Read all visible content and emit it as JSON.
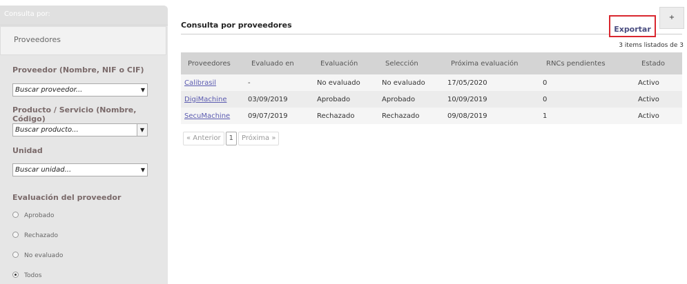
{
  "sidebar": {
    "title": "Consulta por:",
    "tab": "Proveedores",
    "filters": {
      "proveedor_label": "Proveedor (Nombre, NIF o CIF)",
      "proveedor_value": "Buscar proveedor...",
      "producto_label": "Producto / Servicio (Nombre, Código)",
      "producto_value": "Buscar producto...",
      "unidad_label": "Unidad",
      "unidad_value": "Buscar unidad...",
      "evaluacion_label": "Evaluación del proveedor",
      "radios": [
        "Aprobado",
        "Rechazado",
        "No evaluado",
        "Todos"
      ],
      "selected_radio": "Todos"
    }
  },
  "main": {
    "title": "Consulta por proveedores",
    "export_label": "Exportar",
    "plus_label": "+",
    "items_count": "3 items listados de 3",
    "columns": [
      "Proveedores",
      "Evaluado en",
      "Evaluación",
      "Selección",
      "Próxima evaluación",
      "RNCs pendientes",
      "Estado"
    ],
    "rows": [
      [
        "Calibrasil",
        "-",
        "No evaluado",
        "No evaluado",
        "17/05/2020",
        "0",
        "Activo"
      ],
      [
        "DigiMachine",
        "03/09/2019",
        "Aprobado",
        "Aprobado",
        "10/09/2019",
        "0",
        "Activo"
      ],
      [
        "SecuMachine",
        "09/07/2019",
        "Rechazado",
        "Rechazado",
        "09/08/2019",
        "1",
        "Activo"
      ]
    ],
    "pager": {
      "prev": "« Anterior",
      "current": "1",
      "next": "Próxima »"
    }
  },
  "colors": {
    "export_border": "#d9262e",
    "link": "#5a5ab0",
    "header_bg": "#d4d4d4"
  }
}
